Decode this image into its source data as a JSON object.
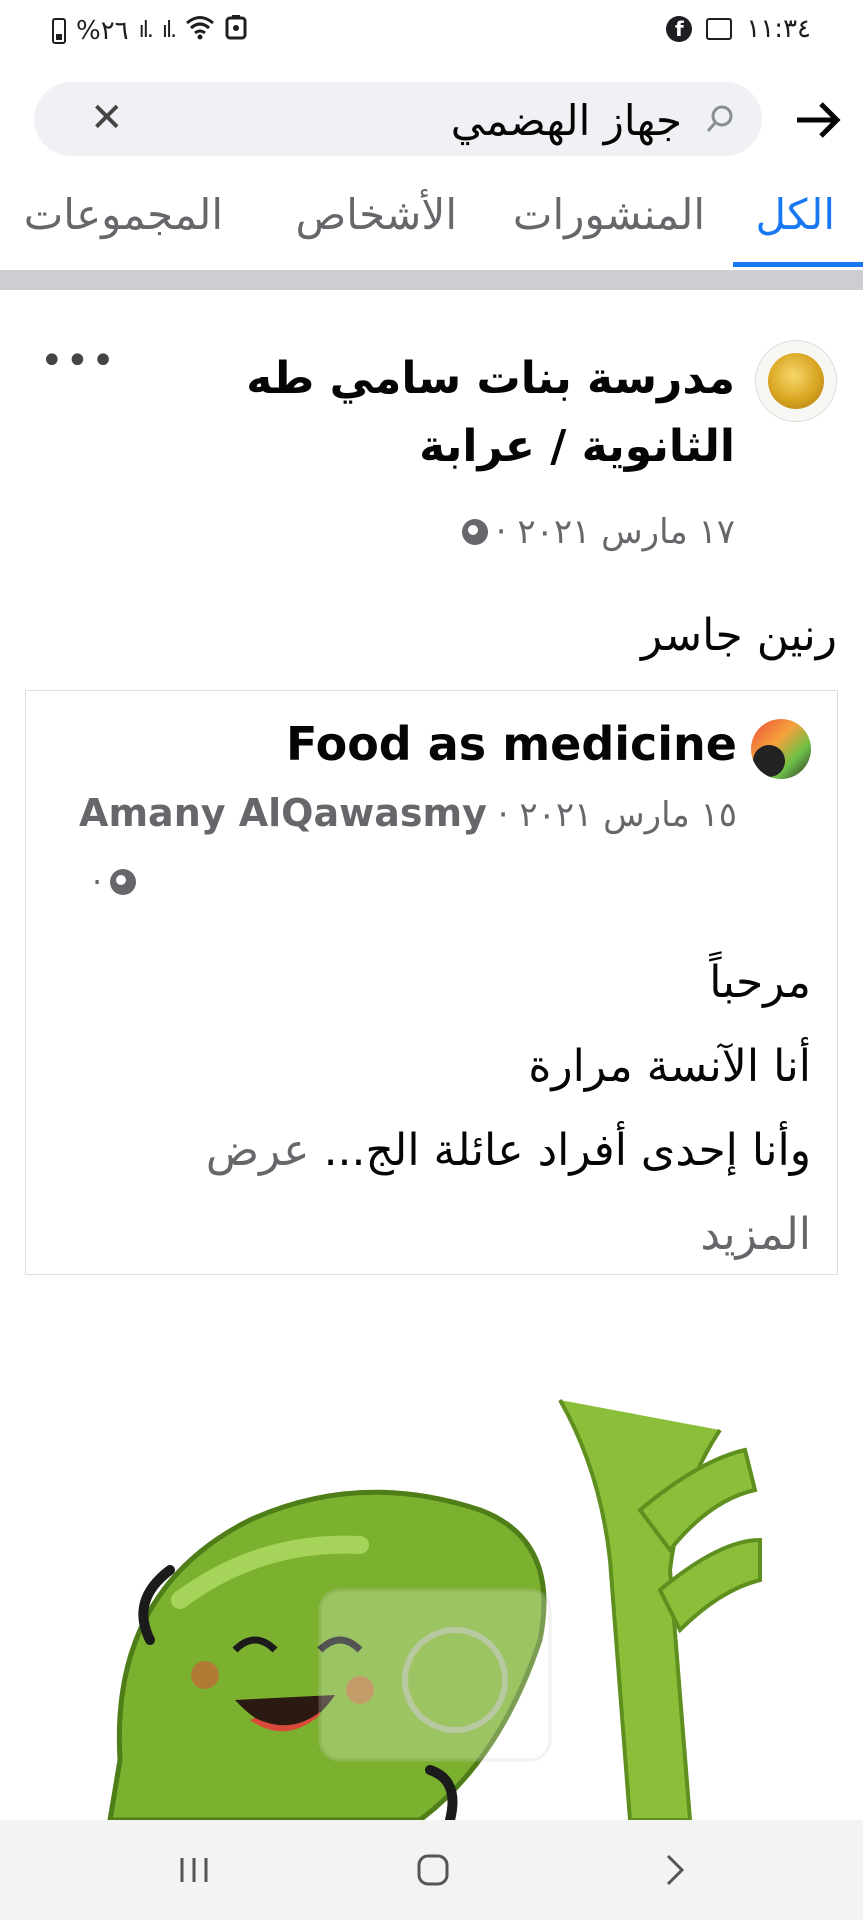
{
  "status_bar": {
    "time": "١١:٣٤",
    "battery": "%٢٦"
  },
  "search": {
    "query": "جهاز الهضمي"
  },
  "tabs": [
    {
      "label": "الكل",
      "active": true
    },
    {
      "label": "المنشورات",
      "active": false
    },
    {
      "label": "الأشخاص",
      "active": false
    },
    {
      "label": "المجموعات",
      "active": false
    }
  ],
  "post": {
    "page_name": "مدرسة بنات سامي طه الثانوية / عرابة",
    "date": "١٧ مارس ٢٠٢١ ·",
    "text": "رنين جاسر",
    "shared": {
      "name": "Food as medicine",
      "date": "١٥ مارس ٢٠٢١ ·",
      "author": "Amany AlQawasmy",
      "meta_suffix": "·",
      "text_lines": [
        "مرحباً",
        "أنا الآنسة مرارة",
        "وأنا إحدى أفراد عائلة الج..."
      ],
      "see_more": "عرض المزيد"
    }
  },
  "colors": {
    "accent": "#1877f2",
    "muted": "#65676b"
  }
}
